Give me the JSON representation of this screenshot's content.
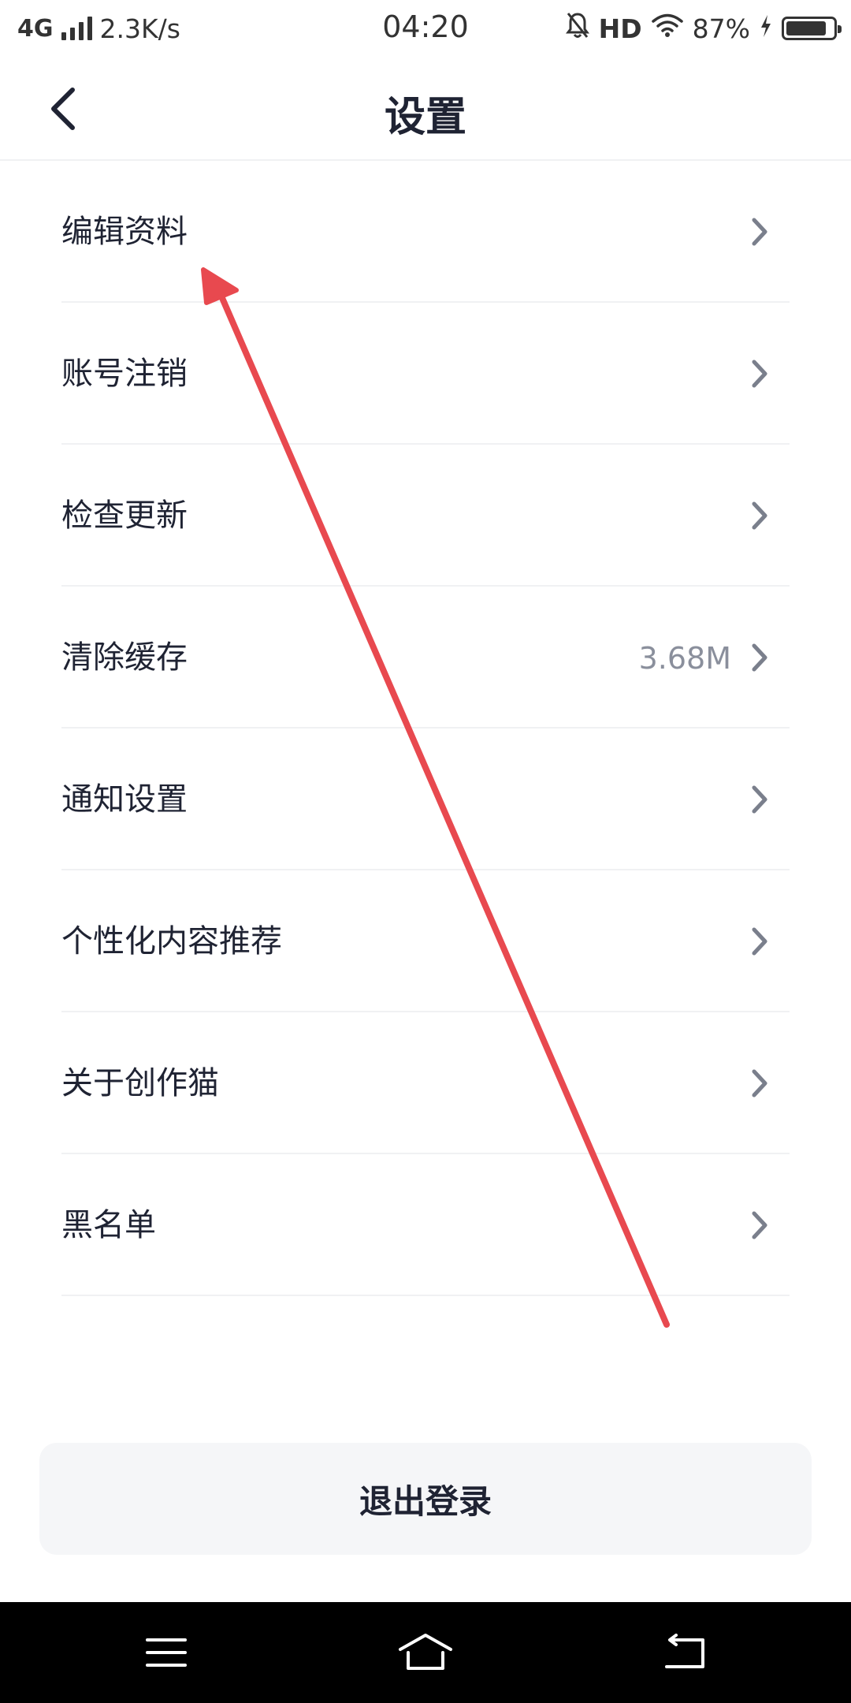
{
  "status_bar": {
    "network": "4G",
    "speed": "2.3K/s",
    "time": "04:20",
    "hd": "HD",
    "battery_text": "87%",
    "battery_level": 0.87
  },
  "header": {
    "title": "设置",
    "back_icon": "chevron-left-icon"
  },
  "settings": [
    {
      "label": "编辑资料",
      "value": ""
    },
    {
      "label": "账号注销",
      "value": ""
    },
    {
      "label": "检查更新",
      "value": ""
    },
    {
      "label": "清除缓存",
      "value": "3.68M"
    },
    {
      "label": "通知设置",
      "value": ""
    },
    {
      "label": "个性化内容推荐",
      "value": ""
    },
    {
      "label": "关于创作猫",
      "value": ""
    },
    {
      "label": "黑名单",
      "value": ""
    }
  ],
  "logout": {
    "label": "退出登录"
  },
  "colors": {
    "text": "#1f2333",
    "secondary": "#8a8f9c",
    "divider": "#f0f1f3",
    "button_bg": "#f5f6f8",
    "annotation_arrow": "#e8494f"
  },
  "nav_bar": {
    "icons": [
      "menu-icon",
      "home-icon",
      "back-icon"
    ]
  }
}
